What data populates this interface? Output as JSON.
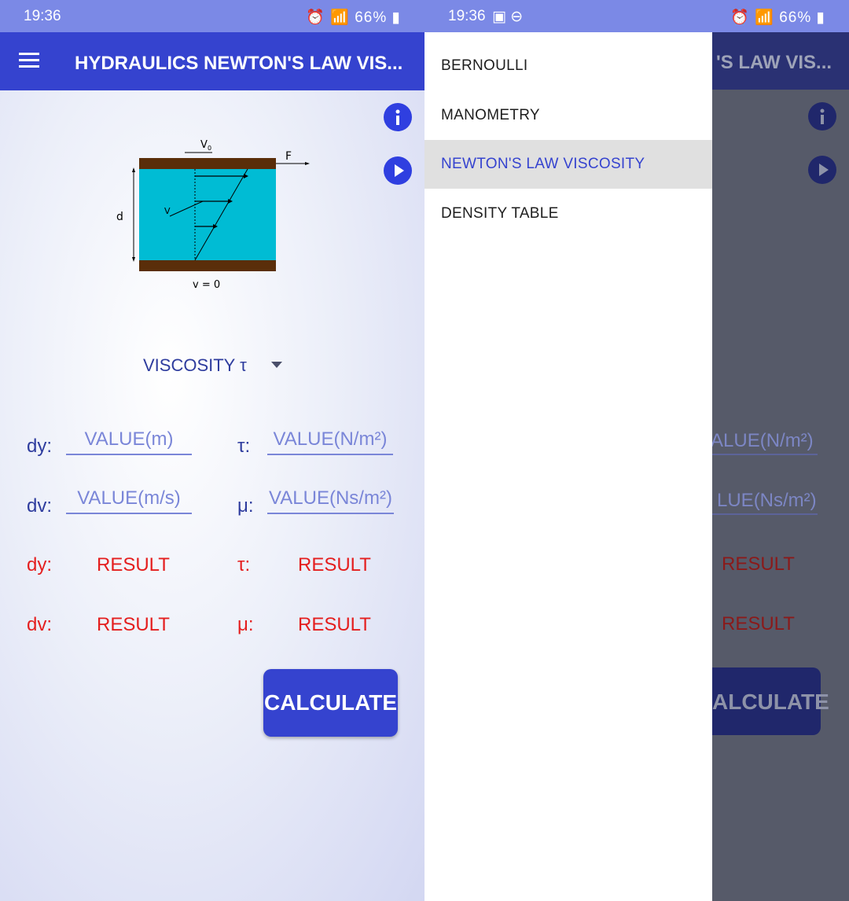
{
  "status_left": {
    "time": "19:36",
    "battery": "66%"
  },
  "status_right": {
    "time": "19:36",
    "battery": "66%"
  },
  "appbar": {
    "title": "HYDRAULICS NEWTON'S LAW VIS...",
    "title_clipped": "'S LAW VIS..."
  },
  "diagram": {
    "top_velocity": "V",
    "top_velocity_sub": "0",
    "force": "F",
    "gap": "d",
    "inner_velocity": "V",
    "bottom_velocity": "v = 0"
  },
  "selector": {
    "value": "VISCOSITY τ"
  },
  "inputs": {
    "dy": {
      "label": "dy:",
      "placeholder": "VALUE(m)"
    },
    "dv": {
      "label": "dv:",
      "placeholder": "VALUE(m/s)"
    },
    "tau": {
      "label": "τ:",
      "placeholder": "VALUE(N/m²)"
    },
    "mu": {
      "label": "μ:",
      "placeholder": "VALUE(Ns/m²)"
    }
  },
  "results": {
    "dy": {
      "label": "dy:",
      "value": "RESULT"
    },
    "dv": {
      "label": "dv:",
      "value": "RESULT"
    },
    "tau": {
      "label": "τ:",
      "value": "RESULT"
    },
    "mu": {
      "label": "μ:",
      "value": "RESULT"
    }
  },
  "button": {
    "calculate": "CALCULATE",
    "calculate_clipped": "ALCULATE"
  },
  "drawer": {
    "items": [
      {
        "label": "BERNOULLI"
      },
      {
        "label": "MANOMETRY"
      },
      {
        "label": "NEWTON'S LAW VISCOSITY",
        "active": true
      },
      {
        "label": "DENSITY TABLE"
      }
    ]
  },
  "dim_fragments": {
    "tau_field": "ALUE(N/m²)",
    "mu_field": "LUE(Ns/m²)",
    "result": "RESULT"
  },
  "colors": {
    "appbar": "#3543cf",
    "status": "#7b89e6",
    "result": "#e41e1e",
    "label": "#2e3c9e",
    "fluid": "#00bcd4",
    "plate": "#5a2e0a"
  }
}
